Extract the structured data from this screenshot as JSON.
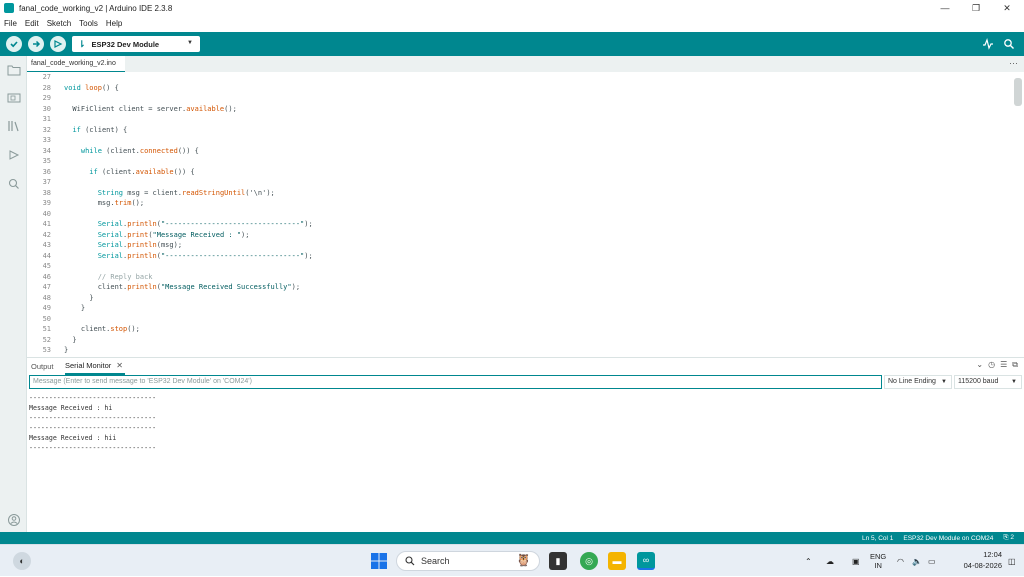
{
  "window": {
    "title": "fanal_code_working_v2 | Arduino IDE 2.3.8",
    "minimize": "—",
    "maximize": "❐",
    "close": "✕"
  },
  "menu": [
    "File",
    "Edit",
    "Sketch",
    "Tools",
    "Help"
  ],
  "toolbar": {
    "board": "ESP32 Dev Module",
    "verify_icon": "check-icon",
    "upload_icon": "arrow-right-icon",
    "debug_icon": "debug-icon"
  },
  "tab": {
    "filename": "fanal_code_working_v2.ino",
    "more": "···"
  },
  "code_lines": [
    {
      "n": "27",
      "t": ""
    },
    {
      "n": "28",
      "t": "void loop() {"
    },
    {
      "n": "29",
      "t": ""
    },
    {
      "n": "30",
      "t": "  WiFiClient client = server.available();"
    },
    {
      "n": "31",
      "t": ""
    },
    {
      "n": "32",
      "t": "  if (client) {"
    },
    {
      "n": "33",
      "t": ""
    },
    {
      "n": "34",
      "t": "    while (client.connected()) {"
    },
    {
      "n": "35",
      "t": ""
    },
    {
      "n": "36",
      "t": "      if (client.available()) {"
    },
    {
      "n": "37",
      "t": ""
    },
    {
      "n": "38",
      "t": "        String msg = client.readStringUntil('\\n');"
    },
    {
      "n": "39",
      "t": "        msg.trim();"
    },
    {
      "n": "40",
      "t": ""
    },
    {
      "n": "41",
      "t": "        Serial.println(\"--------------------------------\");"
    },
    {
      "n": "42",
      "t": "        Serial.print(\"Message Received : \");"
    },
    {
      "n": "43",
      "t": "        Serial.println(msg);"
    },
    {
      "n": "44",
      "t": "        Serial.println(\"--------------------------------\");"
    },
    {
      "n": "45",
      "t": ""
    },
    {
      "n": "46",
      "t": "        // Reply back"
    },
    {
      "n": "47",
      "t": "        client.println(\"Message Received Successfully\");"
    },
    {
      "n": "48",
      "t": "      }"
    },
    {
      "n": "49",
      "t": "    }"
    },
    {
      "n": "50",
      "t": ""
    },
    {
      "n": "51",
      "t": "    client.stop();"
    },
    {
      "n": "52",
      "t": "  }"
    },
    {
      "n": "53",
      "t": "}"
    }
  ],
  "panel": {
    "output_tab": "Output",
    "serial_tab": "Serial Monitor",
    "close": "✕",
    "input_placeholder": "Message (Enter to send message to 'ESP32 Dev Module' on 'COM24')",
    "line_ending": "No Line Ending",
    "baud": "115200 baud"
  },
  "serial_output": [
    "--------------------------------",
    "Message Received : hi",
    "--------------------------------",
    "--------------------------------",
    "Message Received : hii",
    "--------------------------------"
  ],
  "status": {
    "position": "Ln 5, Col 1",
    "board_port": "ESP32 Dev Module on COM24",
    "notifications": "2"
  },
  "taskbar": {
    "search": "Search",
    "lang_top": "ENG",
    "lang_bottom": "IN",
    "time": "12:04",
    "date": "04-08-2026"
  },
  "colors": {
    "accent": "#00878f",
    "toolbar_bg": "#00878f",
    "sidebar_bg": "#ecf1f1"
  }
}
